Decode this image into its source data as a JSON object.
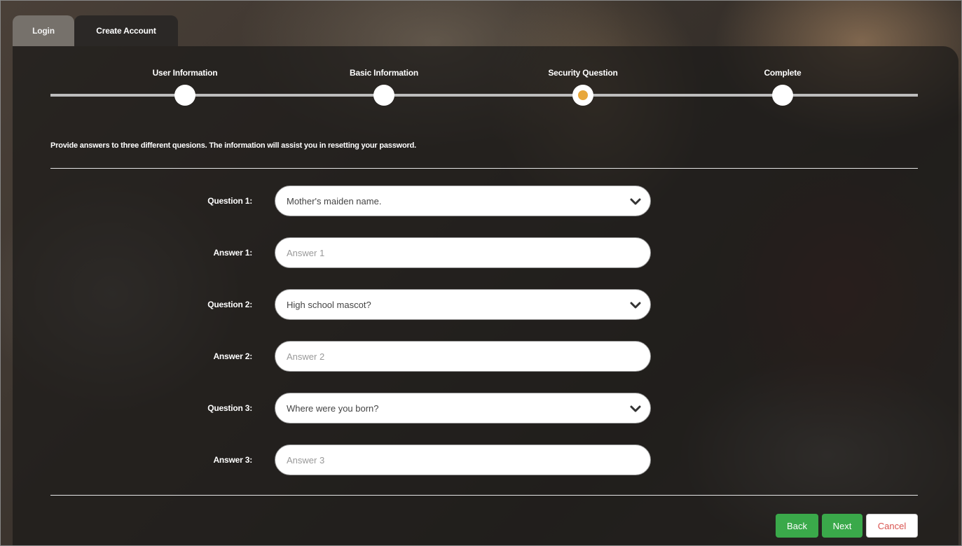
{
  "tabs": {
    "login": "Login",
    "create_account": "Create Account"
  },
  "steps": [
    {
      "label": "User Information",
      "state": "done"
    },
    {
      "label": "Basic Information",
      "state": "done"
    },
    {
      "label": "Security Question",
      "state": "current"
    },
    {
      "label": "Complete",
      "state": "pending"
    }
  ],
  "intro": "Provide answers to three different quesions. The information will assist you in resetting your password.",
  "form": {
    "question1": {
      "label": "Question 1:",
      "value": "Mother's maiden name."
    },
    "answer1": {
      "label": "Answer 1:",
      "placeholder": "Answer 1"
    },
    "question2": {
      "label": "Question 2:",
      "value": "High school mascot?"
    },
    "answer2": {
      "label": "Answer 2:",
      "placeholder": "Answer 2"
    },
    "question3": {
      "label": "Question 3:",
      "value": "Where were you born?"
    },
    "answer3": {
      "label": "Answer 3:",
      "placeholder": "Answer 3"
    }
  },
  "buttons": {
    "back": "Back",
    "next": "Next",
    "cancel": "Cancel"
  },
  "colors": {
    "accent": "#e8a73a",
    "button_green": "#3aa94a",
    "cancel_text": "#d9534f"
  },
  "icons": {
    "dropdown": "chevron-down-icon"
  }
}
